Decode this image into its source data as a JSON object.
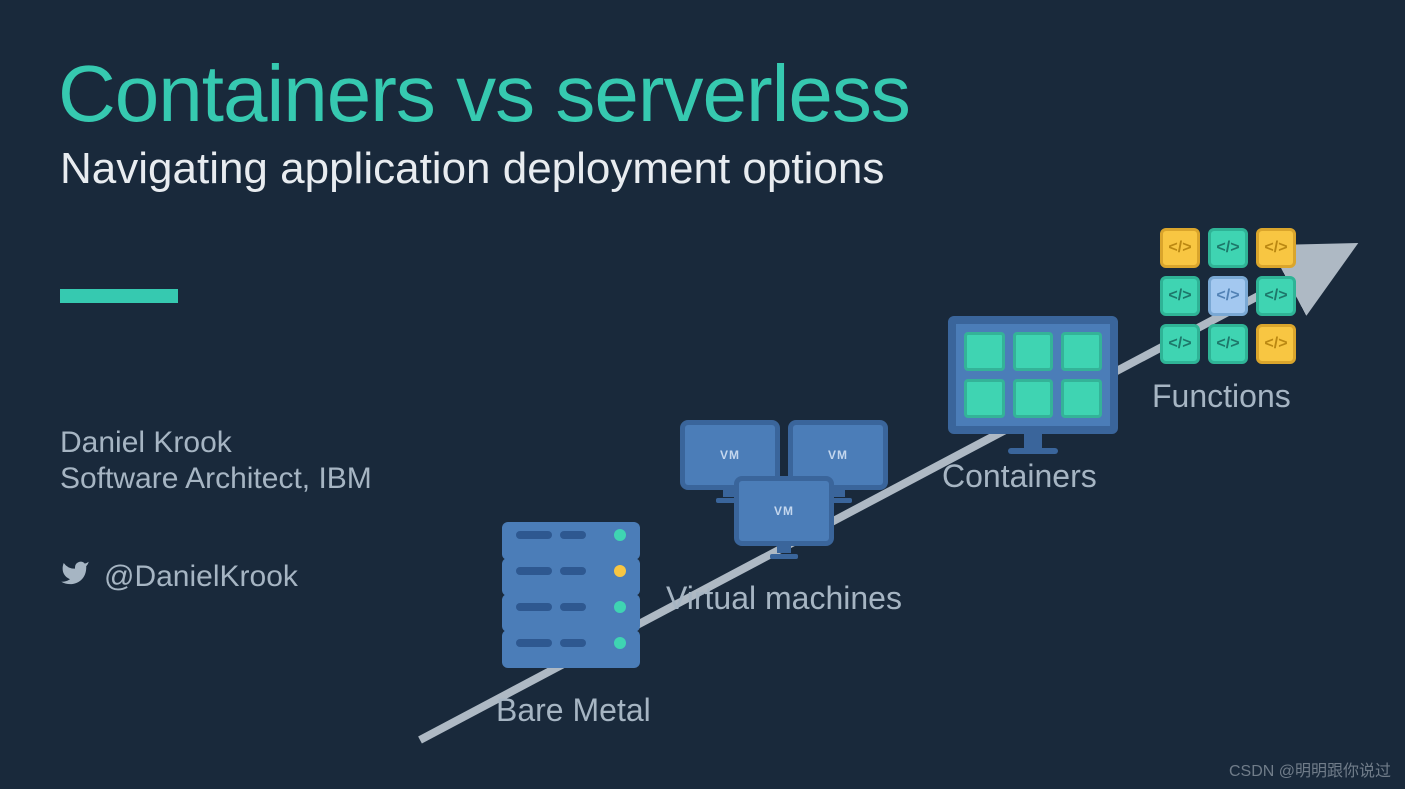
{
  "title": "Containers vs serverless",
  "subtitle": "Navigating application deployment options",
  "author": {
    "name": "Daniel Krook",
    "role": "Software Architect, IBM",
    "handle": "@DanielKrook"
  },
  "labels": {
    "bare_metal": "Bare Metal",
    "virtual_machines": "Virtual machines",
    "containers": "Containers",
    "functions": "Functions"
  },
  "vm_label": "VM",
  "fn_glyph": "</>",
  "watermark": "CSDN @明明跟你说过",
  "colors": {
    "accent": "#36c9b0",
    "bg": "#19293b"
  }
}
